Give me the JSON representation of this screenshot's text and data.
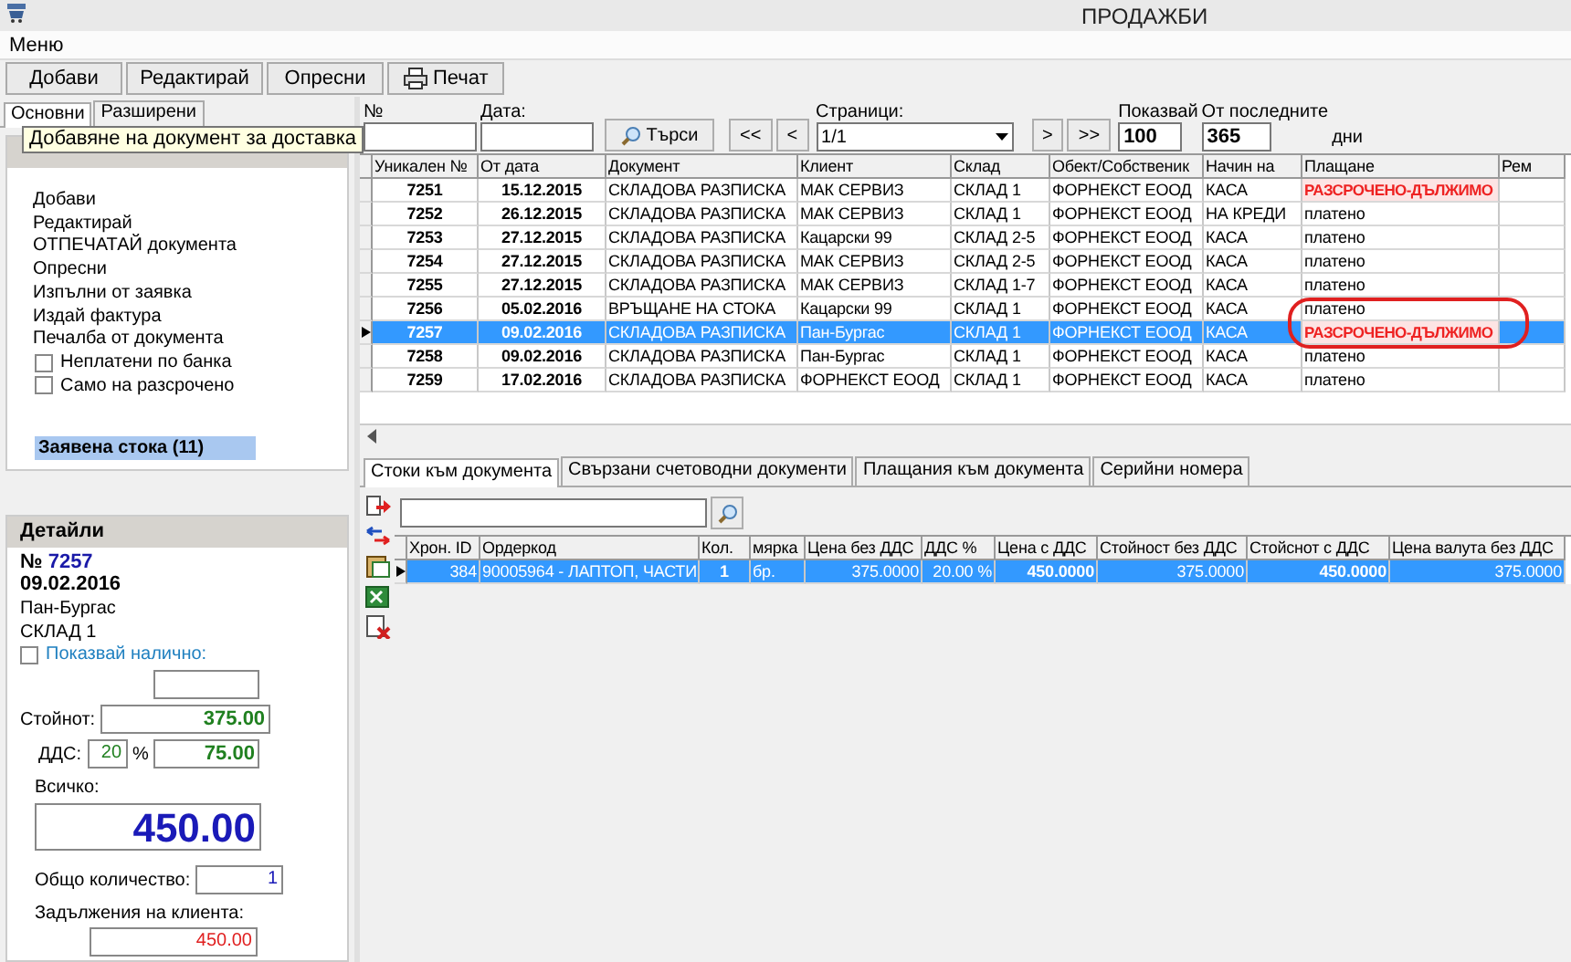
{
  "window": {
    "title": "ПРОДАЖБИ"
  },
  "menu": [
    "Меню"
  ],
  "toolbar": [
    {
      "label": "Добави",
      "kind": "plain"
    },
    {
      "label": "Редактирай",
      "kind": "plain"
    },
    {
      "label": "Опресни",
      "kind": "plain"
    },
    {
      "label": "Печат",
      "kind": "print"
    }
  ],
  "left_tabs": [
    {
      "label": "Основни",
      "selected": true
    },
    {
      "label": "Разширени",
      "selected": false
    }
  ],
  "tooltip": "Добавяне на документ за доставка",
  "actions": {
    "items": [
      "Добави",
      "Редактирай",
      "ОТПЕЧАТАЙ документа",
      "Опресни",
      "Изпълни от заявка",
      "Издай фактура",
      "Печалба от документа"
    ],
    "checkboxes": [
      {
        "label": "Неплатени по банка",
        "checked": false
      },
      {
        "label": "Само на разсрочено",
        "checked": false
      }
    ],
    "requested_goods": "Заявена стока (11)"
  },
  "details": {
    "title": "Детайли",
    "number_label": "№",
    "number": "7257",
    "date": "09.02.2016",
    "client": "Пан-Бургас",
    "warehouse": "СКЛАД 1",
    "show_available": {
      "label": "Показвай налично:",
      "checked": false
    },
    "value_label": "Стойнот:",
    "value": "375.00",
    "vat_label": "ДДС:",
    "vat_rate": "20",
    "percent": "%",
    "vat": "75.00",
    "total_label": "Всичко:",
    "total": "450.00",
    "quantity_label": "Общо количество:",
    "quantity": "1",
    "debts_label": "Задължения на клиента:",
    "debts": "450.00"
  },
  "search": {
    "number_label": "№",
    "date_label": "Дата:",
    "search_button": "Търси",
    "first": "<<",
    "prev": "<",
    "pages_label": "Страници:",
    "page": "1/1",
    "next": ">",
    "last": ">>",
    "show_label": "Показвай",
    "show": "100",
    "last_label": "От последните",
    "days": "365",
    "days_unit": "дни"
  },
  "documents": {
    "columns": [
      "Уникален №",
      "От дата",
      "Документ",
      "Клиент",
      "Склад",
      "Обект/Собственик",
      "Начин на",
      "Плащане",
      "Рем"
    ],
    "rows": [
      {
        "cells": [
          "7251",
          "15.12.2015",
          "СКЛАДОВА РАЗПИСКА",
          "МАК СЕРВИЗ",
          "СКЛАД 1",
          "ФОРНЕКСТ ЕООД",
          "КАСА"
        ],
        "payment": "РАЗСРОЧЕНО-ДЪЛЖИМО",
        "overdue": true,
        "selected": false
      },
      {
        "cells": [
          "7252",
          "26.12.2015",
          "СКЛАДОВА РАЗПИСКА",
          "МАК СЕРВИЗ",
          "СКЛАД 1",
          "ФОРНЕКСТ ЕООД",
          "НА КРЕДИ"
        ],
        "payment": "платено",
        "overdue": false,
        "selected": false
      },
      {
        "cells": [
          "7253",
          "27.12.2015",
          "СКЛАДОВА РАЗПИСКА",
          "Кацарски 99",
          "СКЛАД 2-5",
          "ФОРНЕКСТ ЕООД",
          "КАСА"
        ],
        "payment": "платено",
        "overdue": false,
        "selected": false
      },
      {
        "cells": [
          "7254",
          "27.12.2015",
          "СКЛАДОВА РАЗПИСКА",
          "МАК СЕРВИЗ",
          "СКЛАД 2-5",
          "ФОРНЕКСТ ЕООД",
          "КАСА"
        ],
        "payment": "платено",
        "overdue": false,
        "selected": false
      },
      {
        "cells": [
          "7255",
          "27.12.2015",
          "СКЛАДОВА РАЗПИСКА",
          "МАК СЕРВИЗ",
          "СКЛАД 1-7",
          "ФОРНЕКСТ ЕООД",
          "КАСА"
        ],
        "payment": "платено",
        "overdue": false,
        "selected": false
      },
      {
        "cells": [
          "7256",
          "05.02.2016",
          "ВРЪЩАНЕ НА СТОКА",
          "Кацарски 99",
          "СКЛАД 1",
          "ФОРНЕКСТ ЕООД",
          "КАСА"
        ],
        "payment": "платено",
        "overdue": false,
        "selected": false
      },
      {
        "cells": [
          "7257",
          "09.02.2016",
          "СКЛАДОВА РАЗПИСКА",
          "Пан-Бургас",
          "СКЛАД 1",
          "ФОРНЕКСТ ЕООД",
          "КАСА"
        ],
        "payment": "РАЗСРОЧЕНО-ДЪЛЖИМО",
        "overdue": true,
        "selected": true
      },
      {
        "cells": [
          "7258",
          "09.02.2016",
          "СКЛАДОВА РАЗПИСКА",
          "Пан-Бургас",
          "СКЛАД 1",
          "ФОРНЕКСТ ЕООД",
          "КАСА"
        ],
        "payment": "платено",
        "overdue": false,
        "selected": false
      },
      {
        "cells": [
          "7259",
          "17.02.2016",
          "СКЛАДОВА РАЗПИСКА",
          "ФОРНЕКСТ ЕООД",
          "СКЛАД 1",
          "ФОРНЕКСТ ЕООД",
          "КАСА"
        ],
        "payment": "платено",
        "overdue": false,
        "selected": false
      }
    ]
  },
  "document_tabs": [
    {
      "label": "Стоки към документа",
      "selected": true
    },
    {
      "label": "Свързани счетоводни документи",
      "selected": false
    },
    {
      "label": "Плащания към документа",
      "selected": false
    },
    {
      "label": "Серийни номера",
      "selected": false
    }
  ],
  "items": {
    "columns": [
      "Хрон. ID",
      "Ордеркод",
      "Кол.",
      "мярка",
      "Цена без ДДС",
      "ДДС %",
      "Цена с ДДС",
      "Стойност без ДДС",
      "Стойснот с ДДС",
      "Цена валута без ДДС"
    ],
    "rows": [
      {
        "cells": [
          "384",
          "90005964 - ЛАПТОП, ЧАСТИ",
          "1",
          "бр.",
          "375.0000",
          "20.00 %",
          "450.0000",
          "375.0000",
          "450.0000",
          "375.0000"
        ],
        "selected": true
      }
    ]
  }
}
